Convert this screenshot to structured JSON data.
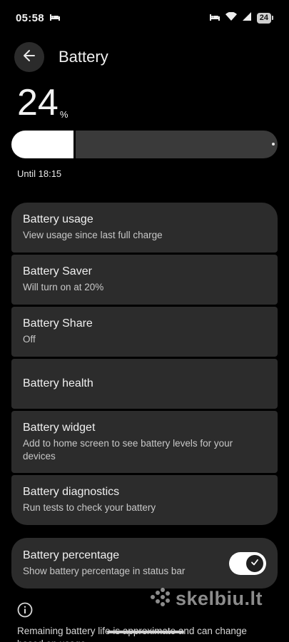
{
  "status_bar": {
    "time": "05:58",
    "battery": "24"
  },
  "header": {
    "title": "Battery"
  },
  "battery": {
    "level": "24",
    "unit": "%",
    "level_fraction": 0.24,
    "until": "Until 18:15"
  },
  "items": [
    {
      "title": "Battery usage",
      "subtitle": "View usage since last full charge"
    },
    {
      "title": "Battery Saver",
      "subtitle": "Will turn on at 20%"
    },
    {
      "title": "Battery Share",
      "subtitle": "Off"
    },
    {
      "title": "Battery health",
      "subtitle": ""
    },
    {
      "title": "Battery widget",
      "subtitle": "Add to home screen to see battery levels for your devices"
    },
    {
      "title": "Battery diagnostics",
      "subtitle": "Run tests to check your battery"
    }
  ],
  "percentage_toggle": {
    "title": "Battery percentage",
    "subtitle": "Show battery percentage in status bar",
    "enabled": true
  },
  "footer": {
    "text": "Remaining battery life is approximate and can change based on usage"
  },
  "watermark": {
    "text": "skelbiu.lt"
  },
  "colors": {
    "background": "#000000",
    "card": "#2c2c2c",
    "meter_fill": "#ffffff",
    "meter_track": "#3a3a3a"
  }
}
